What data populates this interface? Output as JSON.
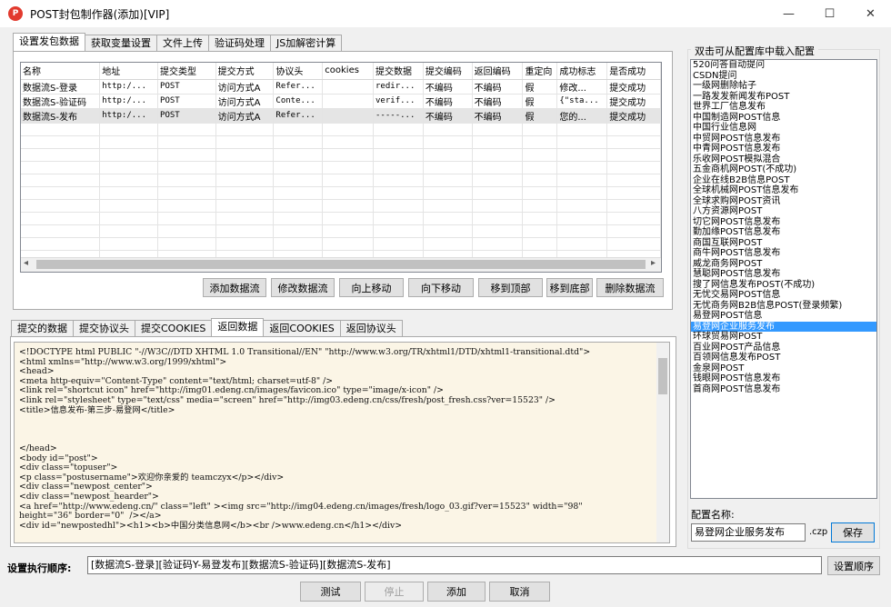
{
  "window": {
    "title": "POST封包制作器(添加)[VIP]",
    "min_glyph": "—",
    "max_glyph": "☐",
    "close_glyph": "✕",
    "app_glyph": "P"
  },
  "top_tabs": [
    "设置发包数据",
    "获取变量设置",
    "文件上传",
    "验证码处理",
    "JS加解密计算"
  ],
  "grid": {
    "columns": [
      "名称",
      "地址",
      "提交类型",
      "提交方式",
      "协议头",
      "cookies",
      "提交数据",
      "提交编码",
      "返回编码",
      "重定向",
      "成功标志",
      "是否成功"
    ],
    "rows": [
      [
        "数据流S-登录",
        "http:/...",
        "POST",
        "访问方式A",
        "Refer...",
        "",
        "redir...",
        "不编码",
        "不编码",
        "假",
        "修改...",
        "提交成功"
      ],
      [
        "数据流S-验证码",
        "http:/...",
        "POST",
        "访问方式A",
        "Conte...",
        "",
        "verif...",
        "不编码",
        "不编码",
        "假",
        "{\"sta...",
        "提交成功"
      ],
      [
        "数据流S-发布",
        "http:/...",
        "POST",
        "访问方式A",
        "Refer...",
        "",
        "-----...",
        "不编码",
        "不编码",
        "假",
        "您的...",
        "提交成功"
      ]
    ],
    "scroll_left": "◂",
    "scroll_right": "▸"
  },
  "grid_buttons": [
    "添加数据流",
    "修改数据流",
    "向上移动",
    "向下移动",
    "移到顶部",
    "移到底部",
    "删除数据流"
  ],
  "bottom_tabs": [
    "提交的数据",
    "提交协议头",
    "提交COOKIES",
    "返回数据",
    "返回COOKIES",
    "返回协议头"
  ],
  "response_html": "<!DOCTYPE html PUBLIC \"-//W3C//DTD XHTML 1.0 Transitional//EN\" \"http://www.w3.org/TR/xhtml1/DTD/xhtml1-transitional.dtd\">\n<html xmlns=\"http://www.w3.org/1999/xhtml\">\n<head>\n<meta http-equiv=\"Content-Type\" content=\"text/html; charset=utf-8\" />\n<link rel=\"shortcut icon\" href=\"http://img01.edeng.cn/images/favicon.ico\" type=\"image/x-icon\" />\n<link rel=\"stylesheet\" type=\"text/css\" media=\"screen\" href=\"http://img03.edeng.cn/css/fresh/post_fresh.css?ver=15523\" />\n<title>信息发布-第三步-易登网</title>\n\n\n\n</head>\n<body id=\"post\">\n<div class=\"topuser\">\n<p class=\"postusername\">欢迎你亲爱的 teamczyx</p></div>\n<div class=\"newpost_center\">\n<div class=\"newpost_hearder\">\n<a href=\"http://www.edeng.cn/\" class=\"left\" ><img src=\"http://img04.edeng.cn/images/fresh/logo_03.gif?ver=15523\" width=\"98\"\nheight=\"36\" border=\"0\"  /></a>\n<div id=\"newpostedhl\"><h1><b>中国分类信息网</b><br />www.edeng.cn</h1></div>",
  "config_library": {
    "title": "双击可从配置库中载入配置",
    "items": [
      "520问答自动提问",
      "CSDN提问",
      "一级网删除帖子",
      "一路发发新闻发布POST",
      "世界工厂信息发布",
      "中国制造网POST信息",
      "中国行业信息网",
      "中贸网POST信息发布",
      "中青网POST信息发布",
      "乐收网POST模拟混合",
      "五金商机网POST(不成功)",
      "企业在线B2B信息POST",
      "全球机械网POST信息发布",
      "全球求购网POST资讯",
      "八方资源网POST",
      "切它网POST信息发布",
      "勤加缘POST信息发布",
      "商国互联网POST",
      "商牛网POST信息发布",
      "威龙商务网POST",
      "慧聪网POST信息发布",
      "搜了网信息发布POST(不成功)",
      "无忧交易网POST信息",
      "无忧商务网B2B信息POST(登录频繁)",
      "易登网POST信息",
      "易登网企业服务发布",
      "环球贸易网POST",
      "百业网POST产品信息",
      "百领网信息发布POST",
      "金泉网POST",
      "钱眼网POST信息发布",
      "首商网POST信息发布"
    ],
    "selected_index": 25
  },
  "config_name": {
    "label": "配置名称:",
    "value": "易登网企业服务发布",
    "ext": ".czp",
    "save": "保存"
  },
  "exec_order": {
    "label": "设置执行顺序:",
    "value": "[数据流S-登录][验证码Y-易登发布][数据流S-验证码][数据流S-发布]",
    "button": "设置顺序"
  },
  "footer_buttons": {
    "test": "测试",
    "stop": "停止",
    "add": "添加",
    "cancel": "取消"
  }
}
